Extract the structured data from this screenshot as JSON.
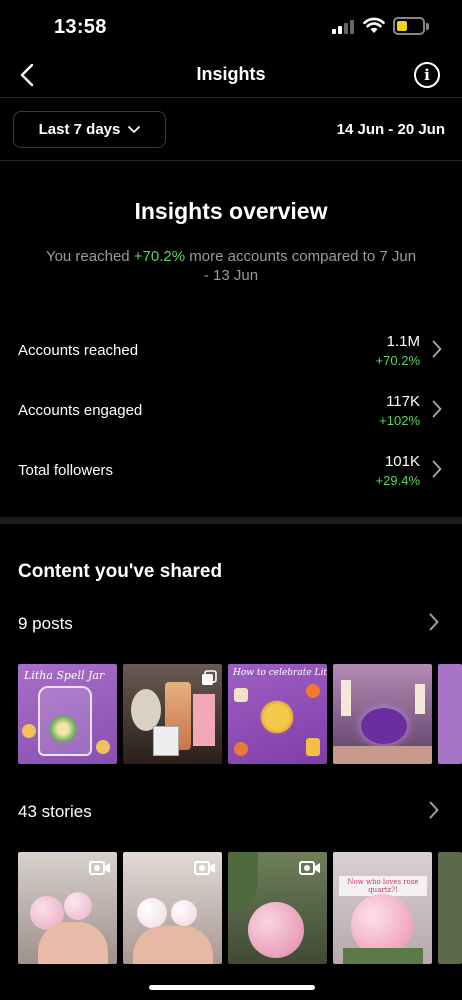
{
  "status": {
    "time": "13:58"
  },
  "nav": {
    "title": "Insights"
  },
  "filter": {
    "range_label": "Last 7 days",
    "date_range": "14 Jun - 20 Jun"
  },
  "overview": {
    "title": "Insights overview",
    "sub_prefix": "You reached ",
    "sub_highlight": "+70.2%",
    "sub_suffix": " more accounts compared to 7 Jun - 13 Jun"
  },
  "metrics": [
    {
      "label": "Accounts reached",
      "value": "1.1M",
      "change": "+70.2%"
    },
    {
      "label": "Accounts engaged",
      "value": "117K",
      "change": "+102%"
    },
    {
      "label": "Total followers",
      "value": "101K",
      "change": "+29.4%"
    }
  ],
  "content": {
    "title": "Content you've shared",
    "posts_label": "9 posts",
    "stories_label": "43 stories",
    "post_texts": [
      "Litha Spell Jar",
      "How to celebrate Litha"
    ],
    "story_text": "Now who loves rose quartz?!"
  },
  "colors": {
    "positive": "#5bd463",
    "battery": "#f2d21b"
  },
  "icons": [
    "back-chevron-icon",
    "info-icon",
    "chevron-down-icon",
    "chevron-right-icon",
    "video-camera-icon",
    "signal-icon",
    "wifi-icon",
    "battery-icon"
  ]
}
